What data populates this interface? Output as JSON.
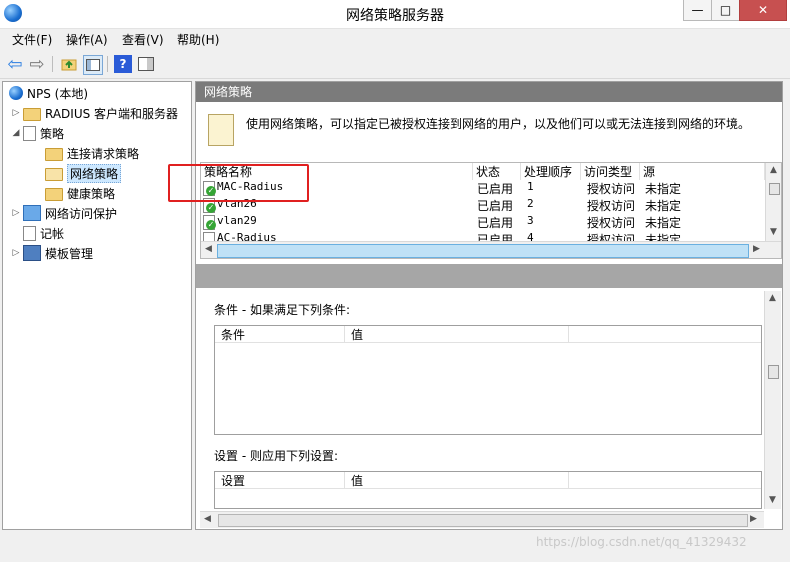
{
  "window": {
    "title": "网络策略服务器",
    "min_glyph": "—",
    "max_glyph": "□",
    "close_glyph": "✕"
  },
  "menu": {
    "file": "文件(F)",
    "action": "操作(A)",
    "view": "查看(V)",
    "help": "帮助(H)"
  },
  "toolbar": {
    "back_glyph": "⇦",
    "forward_glyph": "⇨",
    "help_glyph": "?"
  },
  "tree": {
    "root": "NPS (本地)",
    "radius_clients": "RADIUS 客户端和服务器",
    "policies": "策略",
    "connection_request": "连接请求策略",
    "network_policies": "网络策略",
    "health_policies": "健康策略",
    "nap": "网络访问保护",
    "accounting": "记帐",
    "templates": "模板管理"
  },
  "panel": {
    "header": "网络策略",
    "description": "使用网络策略，可以指定已被授权连接到网络的用户，以及他们可以或无法连接到网络的环境。"
  },
  "policy_list": {
    "columns": [
      "策略名称",
      "状态",
      "处理顺序",
      "访问类型",
      "源"
    ],
    "rows": [
      {
        "name": "MAC-Radius",
        "status": "已启用",
        "order": "1",
        "access": "授权访问",
        "source": "未指定"
      },
      {
        "name": "vlan26",
        "status": "已启用",
        "order": "2",
        "access": "授权访问",
        "source": "未指定"
      },
      {
        "name": "vlan29",
        "status": "已启用",
        "order": "3",
        "access": "授权访问",
        "source": "未指定"
      },
      {
        "name": "AC-Radius",
        "status": "已启用",
        "order": "4",
        "access": "授权访问",
        "source": "未指定"
      }
    ]
  },
  "conditions": {
    "label": "条件 - 如果满足下列条件:",
    "col_condition": "条件",
    "col_value": "值"
  },
  "settings": {
    "label": "设置 - 则应用下列设置:",
    "col_setting": "设置",
    "col_value": "值"
  },
  "watermark": "https://blog.csdn.net/qq_41329432",
  "colors": {
    "highlight_box": "#e02020",
    "panel_header": "#7b7b7b",
    "enabled_check": "#35a535"
  }
}
